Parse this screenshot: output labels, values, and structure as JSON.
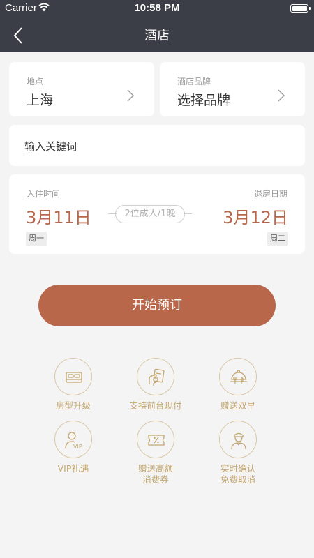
{
  "status_bar": {
    "carrier": "Carrier",
    "time": "10:58 PM"
  },
  "nav": {
    "title": "酒店"
  },
  "location": {
    "label": "地点",
    "value": "上海"
  },
  "brand": {
    "label": "酒店品牌",
    "value": "选择品牌"
  },
  "keyword": {
    "placeholder": "输入关键词"
  },
  "dates": {
    "checkin_label": "入住时间",
    "checkout_label": "退房日期",
    "checkin_date": "3月11日",
    "checkout_date": "3月12日",
    "guests": "2位成人/1晚",
    "checkin_weekday": "周一",
    "checkout_weekday": "周二"
  },
  "book_button": "开始预订",
  "features": [
    {
      "label": "房型升级",
      "icon": "bed-icon"
    },
    {
      "label": "支持前台现付",
      "icon": "hand-card-icon"
    },
    {
      "label": "赠送双早",
      "icon": "food-cloche-icon"
    },
    {
      "label": "VIP礼遇",
      "icon": "vip-person-icon"
    },
    {
      "label": "赠送高额\n消费券",
      "icon": "coupon-icon"
    },
    {
      "label": "实时确认\n免费取消",
      "icon": "concierge-icon"
    }
  ],
  "colors": {
    "header": "#3b3e47",
    "accent": "#b8674b",
    "feature_gold": "#c2a66f",
    "background": "#f4f4f4"
  }
}
